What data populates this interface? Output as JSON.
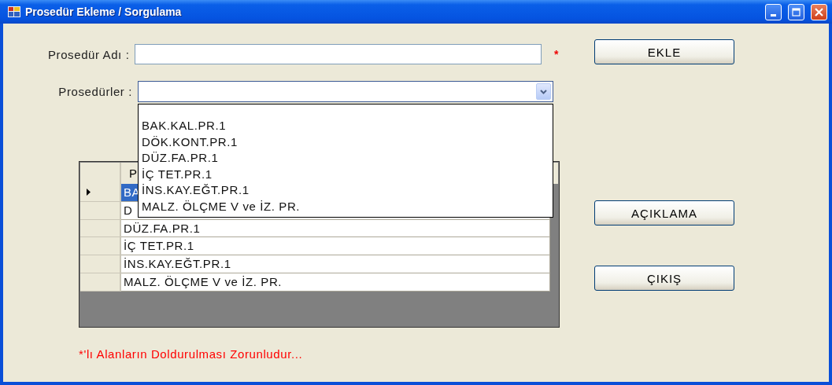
{
  "window": {
    "title": "Prosedür Ekleme / Sorgulama"
  },
  "form": {
    "name_label": "Prosedür Adı :",
    "required_mark": "*",
    "procedures_label": "Prosedürler :"
  },
  "dropdown": {
    "expanded": true,
    "options": [
      "BAK.KAL.PR.1",
      "DÖK.KONT.PR.1",
      "DÜZ.FA.PR.1",
      "İÇ TET.PR.1",
      "İNS.KAY.EĞT.PR.1",
      "MALZ. ÖLÇME V ve İZ. PR."
    ]
  },
  "grid": {
    "column_header": "P",
    "rows": [
      {
        "cell": "BA",
        "selected": true
      },
      {
        "cell": "D",
        "selected": false
      },
      {
        "cell": "DÜZ.FA.PR.1",
        "selected": false
      },
      {
        "cell": "İÇ TET.PR.1",
        "selected": false
      },
      {
        "cell": "İNS.KAY.EĞT.PR.1",
        "selected": false
      },
      {
        "cell": "MALZ. ÖLÇME V ve İZ. PR.",
        "selected": false
      }
    ]
  },
  "buttons": [
    {
      "label": "EKLE"
    },
    {
      "label": "AÇIKLAMA"
    },
    {
      "label": "ÇIKIŞ"
    }
  ],
  "message": "*'lı Alanların Doldurulması Zorunludur..."
}
